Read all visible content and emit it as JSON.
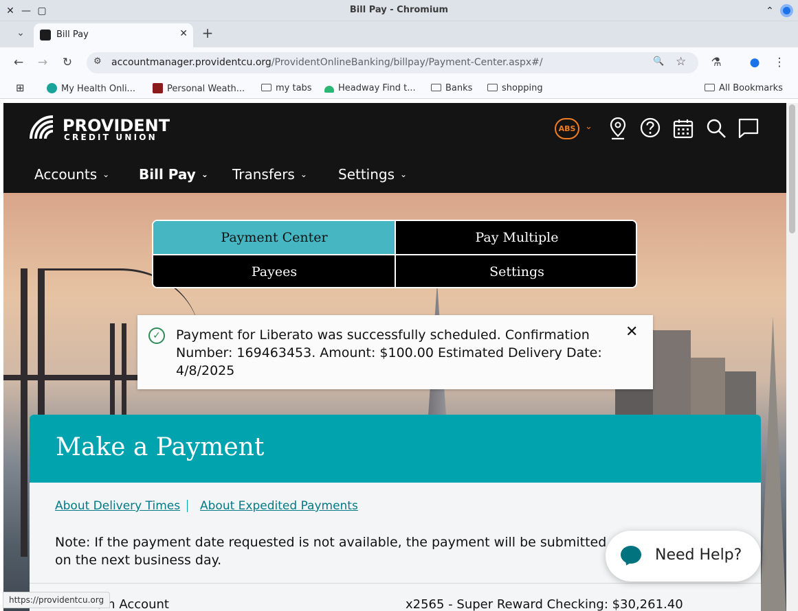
{
  "window": {
    "title": "Bill Pay - Chromium",
    "close_glyph": "✕",
    "minimize_glyph": "—",
    "maximize_glyph": "▢",
    "collapse_glyph": "⌃"
  },
  "tabs": {
    "list_glyph": "⌄",
    "active_title": "Bill Pay",
    "close_glyph": "✕",
    "new_tab_glyph": "+"
  },
  "toolbar": {
    "back_glyph": "←",
    "forward_glyph": "→",
    "reload_glyph": "↻",
    "url_host": "accountmanager.providentcu.org",
    "url_path": "/ProvidentOnlineBanking/billpay/Payment-Center.aspx#/",
    "zoom_glyph": "🔍",
    "star_glyph": "☆",
    "labs_glyph": "⚗",
    "profile_glyph": "●",
    "menu_glyph": "⋮"
  },
  "bookmarks": [
    {
      "label": "My Health Onli...",
      "icon": "health-icon",
      "color": "#1aa39a"
    },
    {
      "label": "Personal Weath...",
      "icon": "weather-icon",
      "color": "#8b1a1a"
    },
    {
      "label": "my tabs",
      "icon": "folder-icon"
    },
    {
      "label": "Headway Find t...",
      "icon": "headway-icon",
      "color": "#2bb673"
    },
    {
      "label": "Banks",
      "icon": "folder-icon"
    },
    {
      "label": "shopping",
      "icon": "folder-icon"
    }
  ],
  "all_bookmarks_label": "All Bookmarks",
  "site": {
    "logo_word": "PROVIDENT",
    "logo_sub": "CREDIT UNION",
    "user_initials": "ABS",
    "brand_orange": "#f07d23",
    "brand_teal": "#00a3ae",
    "nav": [
      {
        "label": "Accounts"
      },
      {
        "label": "Bill Pay"
      },
      {
        "label": "Transfers"
      },
      {
        "label": "Settings"
      }
    ],
    "caret_glyph": "⌄"
  },
  "subnav": {
    "payment_center": "Payment Center",
    "pay_multiple": "Pay Multiple",
    "payees": "Payees",
    "settings": "Settings"
  },
  "alert": {
    "message": "Payment for Liberato was successfully scheduled. Confirmation Number: 169463453. Amount: $100.00 Estimated Delivery Date: 4/8/2025",
    "check_glyph": "✓",
    "close_glyph": "✕"
  },
  "payment": {
    "title": "Make a Payment",
    "link_delivery": "About Delivery Times",
    "link_expedited": "About Expedited Payments",
    "note": "Note: If the payment date requested is not available, the payment will be submitted on the next business day.",
    "from_label": "From Account",
    "from_value": "x2565 - Super Reward Checking: $30,261.40"
  },
  "help": {
    "label": "Need Help?"
  },
  "status_url": "https://providentcu.org"
}
